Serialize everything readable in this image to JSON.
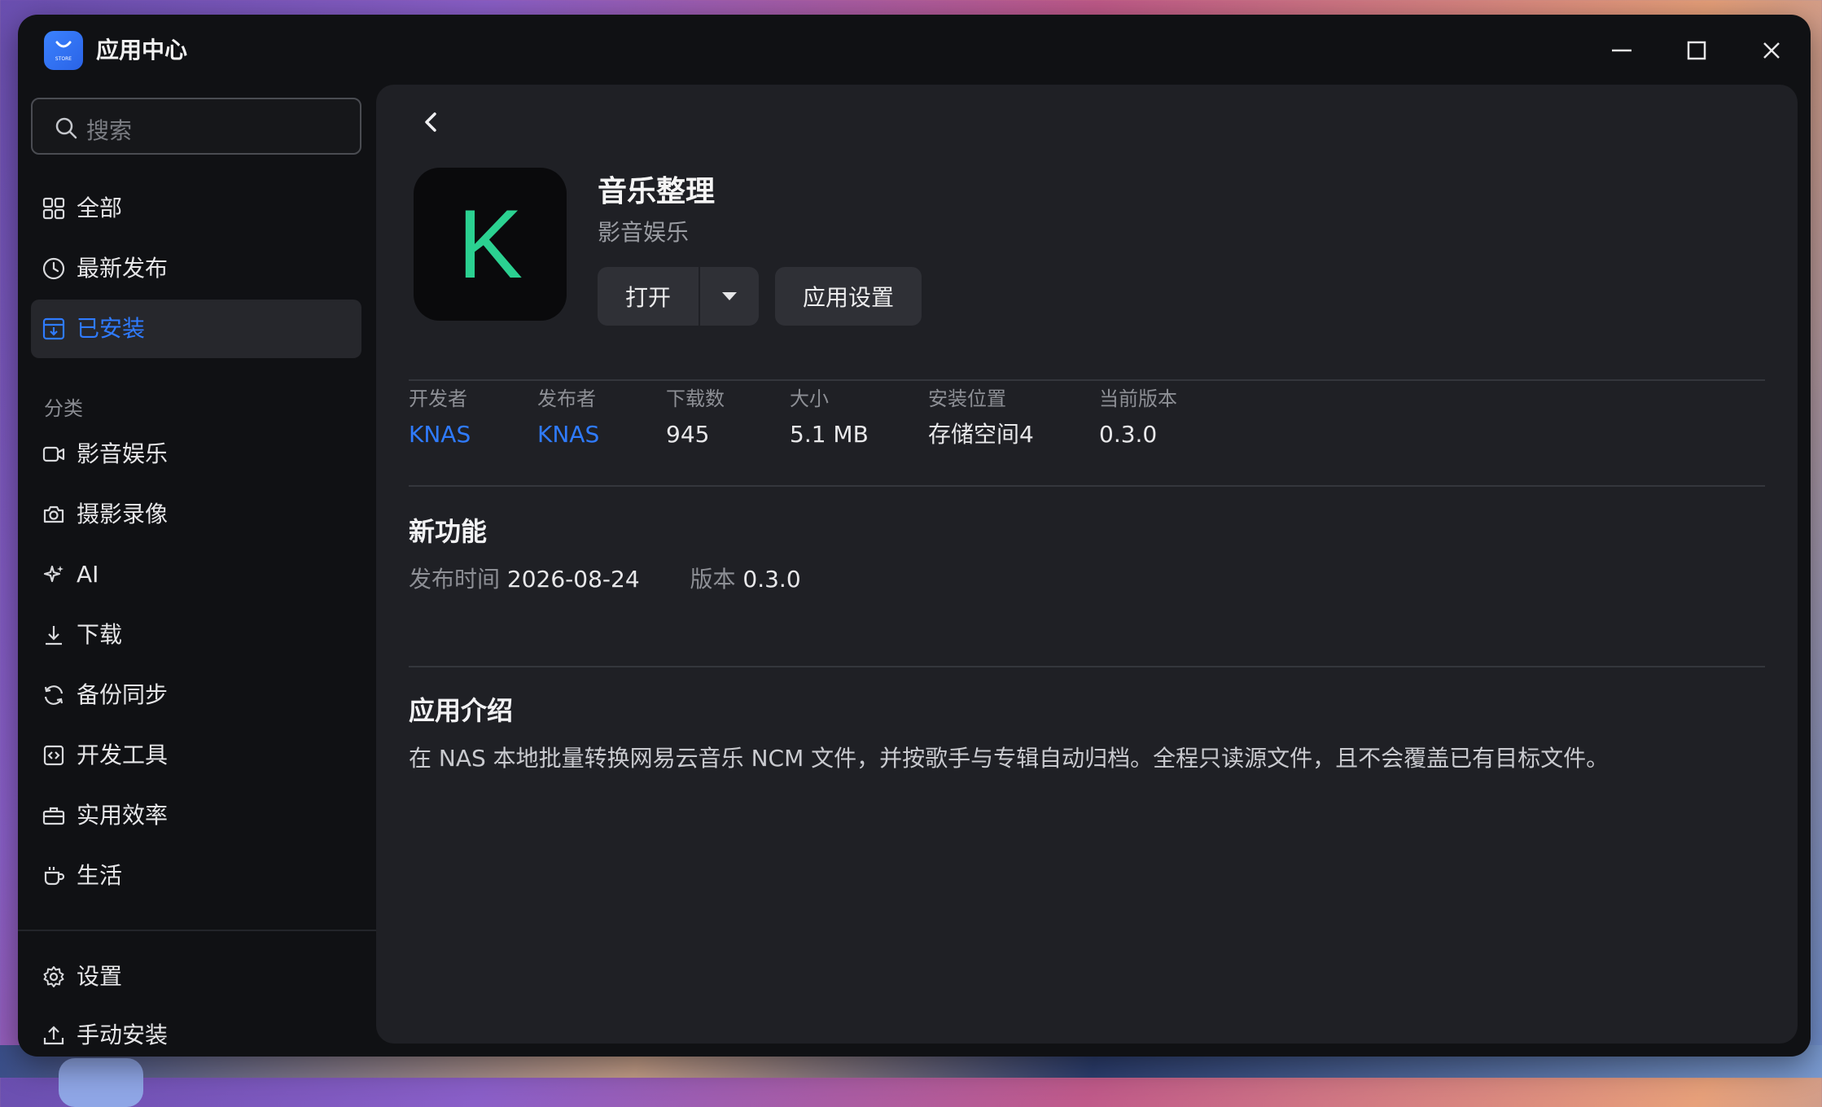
{
  "window": {
    "title": "应用中心",
    "logo_text": "STORE"
  },
  "sidebar": {
    "search_placeholder": "搜索",
    "nav": [
      {
        "label": "全部",
        "icon": "grid-icon"
      },
      {
        "label": "最新发布",
        "icon": "clock-icon"
      },
      {
        "label": "已安装",
        "icon": "installed-icon",
        "active": true
      }
    ],
    "category_label": "分类",
    "categories": [
      {
        "label": "影音娱乐",
        "icon": "video-icon"
      },
      {
        "label": "摄影录像",
        "icon": "camera-icon"
      },
      {
        "label": "AI",
        "icon": "sparkle-icon"
      },
      {
        "label": "下载",
        "icon": "download-icon"
      },
      {
        "label": "备份同步",
        "icon": "sync-icon"
      },
      {
        "label": "开发工具",
        "icon": "code-icon"
      },
      {
        "label": "实用效率",
        "icon": "toolbox-icon"
      },
      {
        "label": "生活",
        "icon": "cup-icon"
      }
    ],
    "footer": [
      {
        "label": "设置",
        "icon": "gear-icon"
      },
      {
        "label": "手动安装",
        "icon": "upload-icon"
      }
    ]
  },
  "app": {
    "icon_letter": "K",
    "name": "音乐整理",
    "category": "影音娱乐",
    "open_label": "打开",
    "settings_label": "应用设置",
    "meta": [
      {
        "key": "开发者",
        "value": "KNAS",
        "link": true
      },
      {
        "key": "发布者",
        "value": "KNAS",
        "link": true
      },
      {
        "key": "下载数",
        "value": "945"
      },
      {
        "key": "大小",
        "value": "5.1 MB"
      },
      {
        "key": "安装位置",
        "value": "存储空间4"
      },
      {
        "key": "当前版本",
        "value": "0.3.0"
      }
    ],
    "whats_new_title": "新功能",
    "release_time_label": "发布时间",
    "release_time": "2026-08-24",
    "version_label": "版本",
    "version": "0.3.0",
    "intro_title": "应用介绍",
    "intro_text": "在 NAS 本地批量转换网易云音乐 NCM 文件，并按歌手与专辑自动归档。全程只读源文件，且不会覆盖已有目标文件。"
  },
  "colors": {
    "accent": "#2f7bff",
    "icon_letter": "#2bd191"
  }
}
